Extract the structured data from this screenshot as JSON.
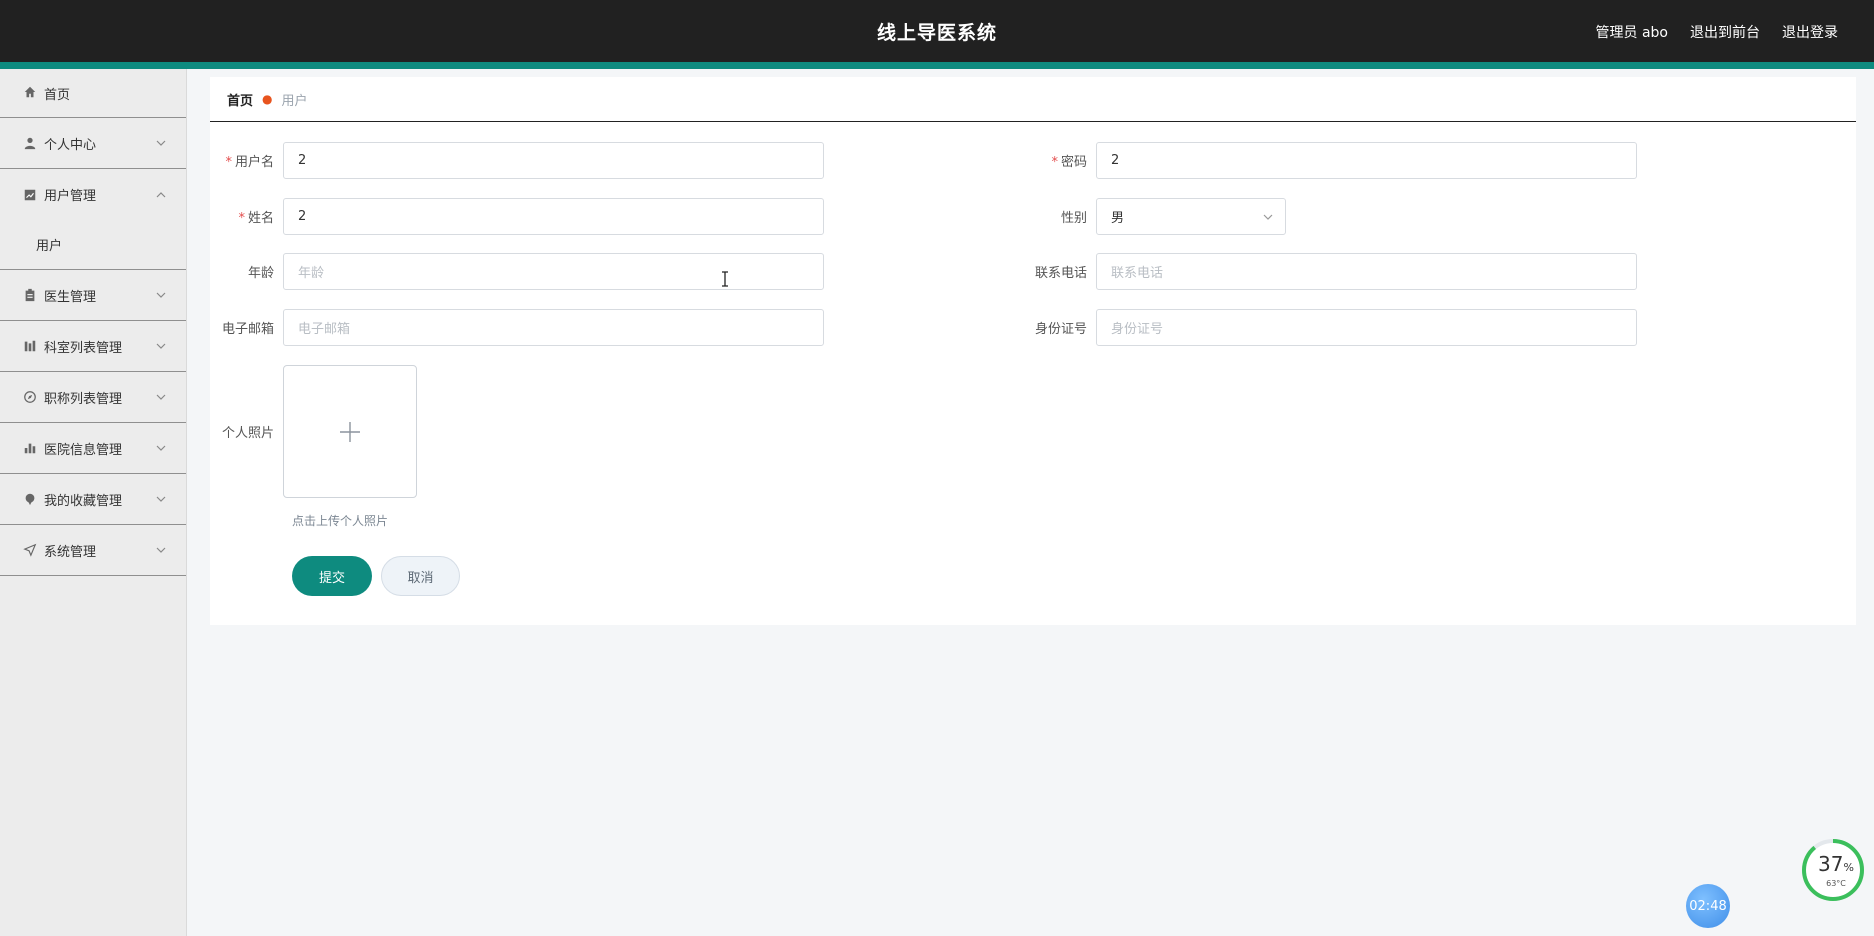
{
  "header": {
    "title": "线上导医系统",
    "admin": "管理员 abo",
    "to_front": "退出到前台",
    "logout": "退出登录"
  },
  "sidebar": {
    "items": [
      {
        "label": "首页",
        "icon": "home-icon"
      },
      {
        "label": "个人中心",
        "icon": "user-icon"
      },
      {
        "label": "用户管理",
        "icon": "chart-icon",
        "expanded": true,
        "children": [
          "用户"
        ]
      },
      {
        "label": "医生管理",
        "icon": "clipboard-icon"
      },
      {
        "label": "科室列表管理",
        "icon": "bars-icon"
      },
      {
        "label": "职称列表管理",
        "icon": "compass-icon"
      },
      {
        "label": "医院信息管理",
        "icon": "bar-chart-icon"
      },
      {
        "label": "我的收藏管理",
        "icon": "pin-icon"
      },
      {
        "label": "系统管理",
        "icon": "send-icon"
      }
    ]
  },
  "breadcrumb": {
    "home": "首页",
    "current": "用户"
  },
  "form": {
    "username": {
      "label": "用户名",
      "value": "2"
    },
    "password": {
      "label": "密码",
      "value": "2"
    },
    "name": {
      "label": "姓名",
      "value": "2"
    },
    "gender": {
      "label": "性别",
      "value": "男"
    },
    "age": {
      "label": "年龄",
      "placeholder": "年龄"
    },
    "phone": {
      "label": "联系电话",
      "placeholder": "联系电话"
    },
    "email": {
      "label": "电子邮箱",
      "placeholder": "电子邮箱"
    },
    "idcard": {
      "label": "身份证号",
      "placeholder": "身份证号"
    },
    "photo": {
      "label": "个人照片",
      "hint": "点击上传个人照片"
    },
    "submit": "提交",
    "cancel": "取消"
  },
  "widgets": {
    "gauge_value": "37",
    "gauge_unit": "%",
    "temp": "63°C",
    "clock": "02:48"
  },
  "colors": {
    "accent": "#0e8b7f",
    "header_bg": "#212121",
    "required": "#e34d4d"
  }
}
